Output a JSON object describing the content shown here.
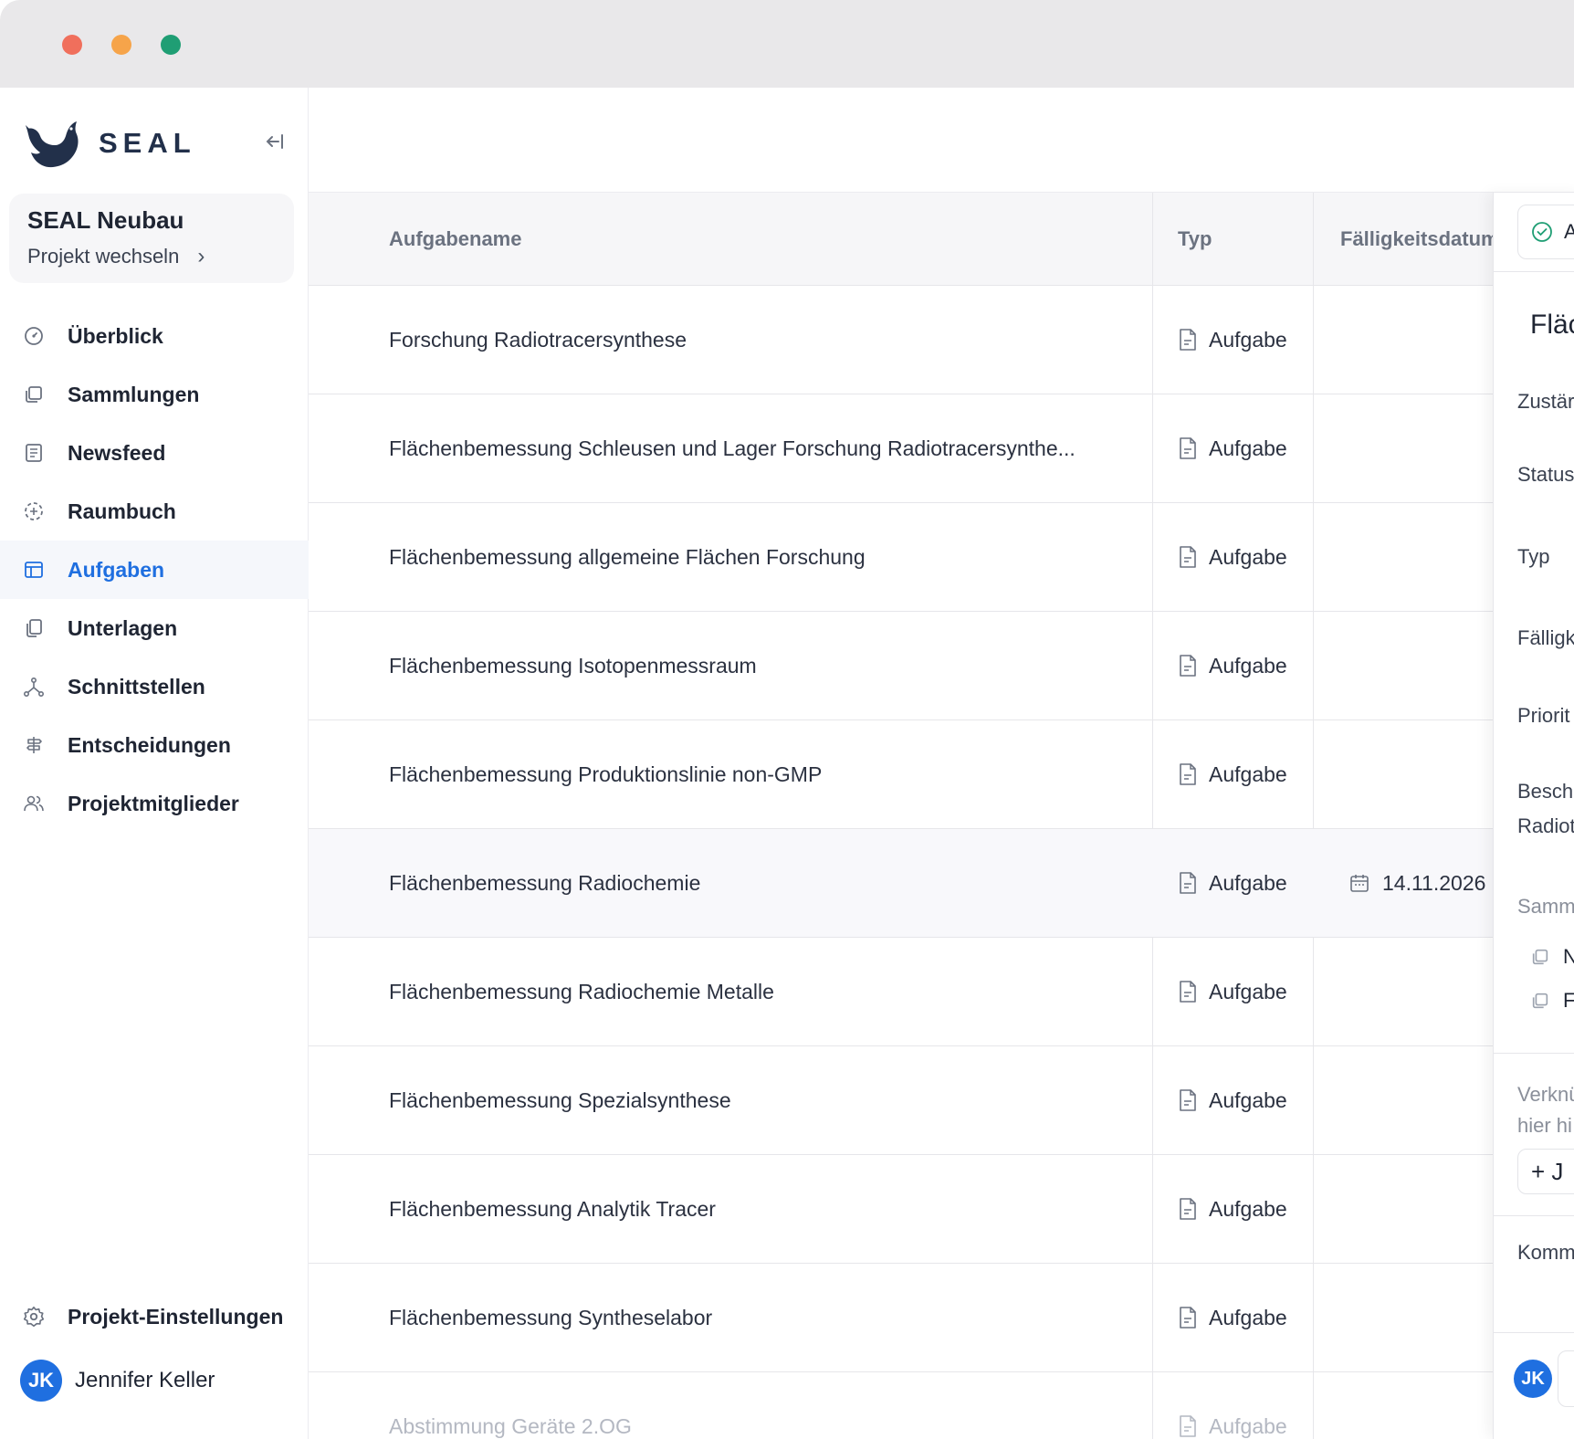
{
  "app": {
    "logo_text": "SEAL",
    "collapse_icon": "collapse-left-icon"
  },
  "project": {
    "name": "SEAL Neubau",
    "switch_label": "Projekt wechseln"
  },
  "nav": {
    "items": [
      {
        "label": "Überblick",
        "icon": "gauge-icon"
      },
      {
        "label": "Sammlungen",
        "icon": "collections-icon"
      },
      {
        "label": "Newsfeed",
        "icon": "newsfeed-icon"
      },
      {
        "label": "Raumbuch",
        "icon": "room-book-icon"
      },
      {
        "label": "Aufgaben",
        "icon": "table-icon",
        "active": true
      },
      {
        "label": "Unterlagen",
        "icon": "documents-icon"
      },
      {
        "label": "Schnittstellen",
        "icon": "interfaces-icon"
      },
      {
        "label": "Entscheidungen",
        "icon": "signpost-icon"
      },
      {
        "label": "Projektmitglieder",
        "icon": "members-icon"
      }
    ],
    "settings_label": "Projekt-Einstellungen"
  },
  "user": {
    "initials": "JK",
    "name": "Jennifer Keller"
  },
  "table": {
    "columns": {
      "name": "Aufgabename",
      "type": "Typ",
      "due": "Fälligkeitsdatum"
    },
    "rows": [
      {
        "name": "Forschung Radiotracersynthese",
        "type": "Aufgabe",
        "due": ""
      },
      {
        "name": "Flächenbemessung Schleusen und Lager Forschung Radiotracersynthe...",
        "type": "Aufgabe",
        "due": ""
      },
      {
        "name": "Flächenbemessung allgemeine Flächen Forschung",
        "type": "Aufgabe",
        "due": ""
      },
      {
        "name": "Flächenbemessung Isotopenmessraum",
        "type": "Aufgabe",
        "due": ""
      },
      {
        "name": "Flächenbemessung Produktionslinie non-GMP",
        "type": "Aufgabe",
        "due": ""
      },
      {
        "name": "Flächenbemessung Radiochemie",
        "type": "Aufgabe",
        "due": "14.11.2026"
      },
      {
        "name": "Flächenbemessung Radiochemie Metalle",
        "type": "Aufgabe",
        "due": ""
      },
      {
        "name": "Flächenbemessung Spezialsynthese",
        "type": "Aufgabe",
        "due": ""
      },
      {
        "name": "Flächenbemessung Analytik Tracer",
        "type": "Aufgabe",
        "due": ""
      },
      {
        "name": "Flächenbemessung Syntheselabor",
        "type": "Aufgabe",
        "due": ""
      },
      {
        "name": "Abstimmung Geräte 2.OG",
        "type": "Aufgabe",
        "due": ""
      }
    ]
  },
  "panel": {
    "action_label": "A",
    "title": "Fläc",
    "labels": {
      "assignee": "Zustär",
      "status": "Status",
      "type": "Typ",
      "due": "Fälligk",
      "priority": "Priorit",
      "description": "Beschr",
      "description_value": "Radiot",
      "collections": "Samm",
      "link_hint_1": "Verknü",
      "link_hint_2": "hier hi",
      "comments": "Komm"
    },
    "collections": [
      "N",
      "F"
    ],
    "add_label": "+ J",
    "avatar_initials": "JK"
  }
}
